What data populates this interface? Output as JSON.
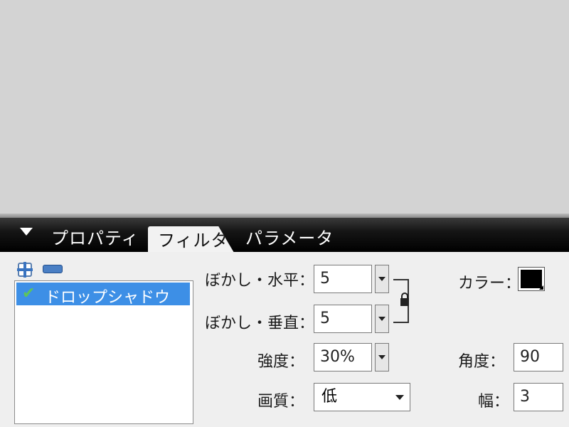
{
  "tabs": {
    "properties": "プロパティ",
    "filters": "フィルタ",
    "parameters": "パラメータ"
  },
  "filter_list": {
    "items": [
      {
        "label": "ドロップシャドウ",
        "enabled": true
      }
    ]
  },
  "settings": {
    "blur_x_label": "ぼかし・水平：",
    "blur_x_value": "5",
    "blur_y_label": "ぼかし・垂直：",
    "blur_y_value": "5",
    "strength_label": "強度：",
    "strength_value": "30%",
    "quality_label": "画質：",
    "quality_value": "低",
    "color_label": "カラー：",
    "color_value": "#000000",
    "angle_label": "角度：",
    "angle_value": "90",
    "distance_label": "幅：",
    "distance_value": "3"
  },
  "colors": {
    "tab_bar": "#000000",
    "selection": "#3d8fe6",
    "stage": "#d3d3d3"
  }
}
